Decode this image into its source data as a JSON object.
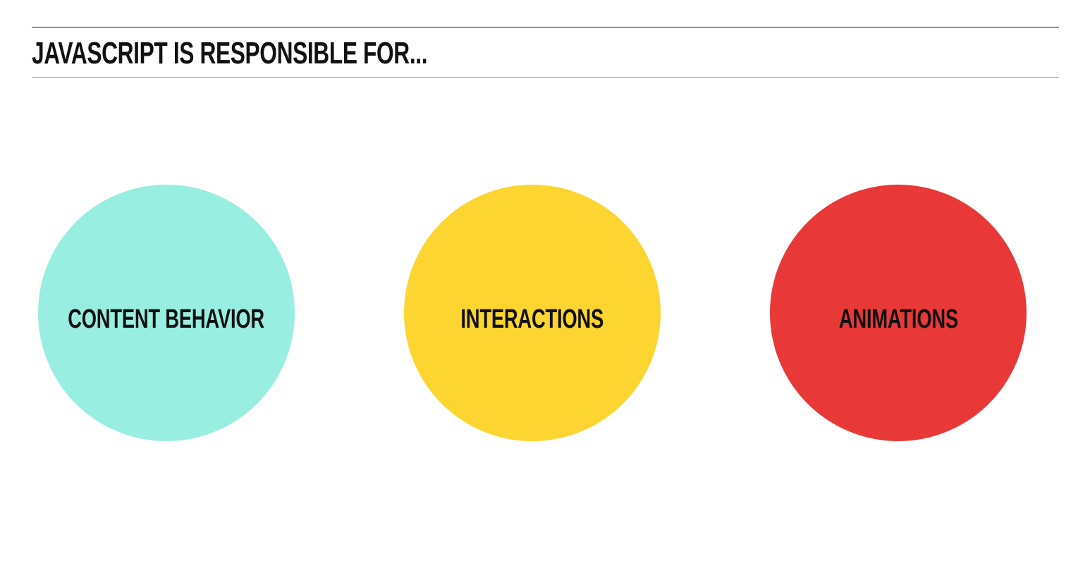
{
  "title": "JAVASCRIPT IS RESPONSIBLE FOR...",
  "items": [
    {
      "label": "CONTENT BEHAVIOR",
      "color": "#98EEE0"
    },
    {
      "label": "INTERACTIONS",
      "color": "#FCD531"
    },
    {
      "label": "ANIMATIONS",
      "color": "#E83838"
    }
  ]
}
